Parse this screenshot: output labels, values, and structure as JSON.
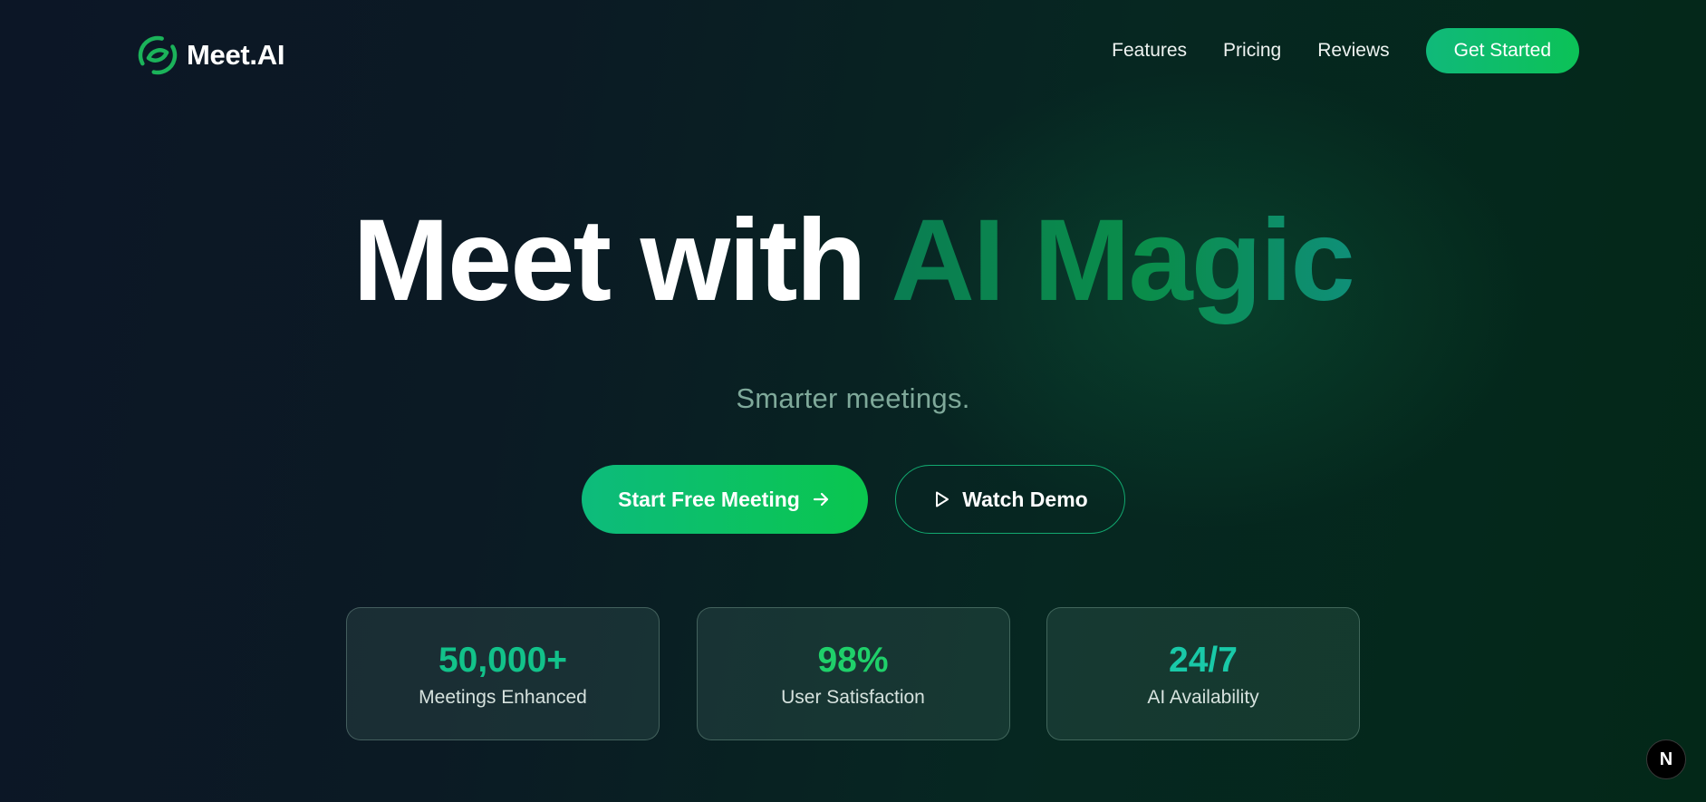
{
  "brand": {
    "name": "Meet.AI",
    "logo_icon": "sync-logo-icon",
    "logo_color": "#1bb35a"
  },
  "nav": {
    "links": [
      {
        "label": "Features"
      },
      {
        "label": "Pricing"
      },
      {
        "label": "Reviews"
      }
    ],
    "cta_label": "Get Started"
  },
  "hero": {
    "title_plain": "Meet with ",
    "title_accent": "AI Magic",
    "subtitle": "Smarter meetings.",
    "primary_button": {
      "label": "Start Free Meeting",
      "icon": "arrow-right-icon"
    },
    "secondary_button": {
      "label": "Watch Demo",
      "icon": "play-icon"
    }
  },
  "stats": [
    {
      "value": "50,000+",
      "label": "Meetings Enhanced",
      "color": "#12c28a"
    },
    {
      "value": "98%",
      "label": "User Satisfaction",
      "color": "#1fd06a"
    },
    {
      "value": "24/7",
      "label": "AI Availability",
      "color": "#19c9a8"
    }
  ],
  "corner_badge": {
    "label": "N",
    "icon": "next-badge-icon"
  },
  "colors": {
    "accent_green": "#10b97a",
    "accent_green_end": "#0ac64e",
    "subtitle": "#7fa99a"
  }
}
